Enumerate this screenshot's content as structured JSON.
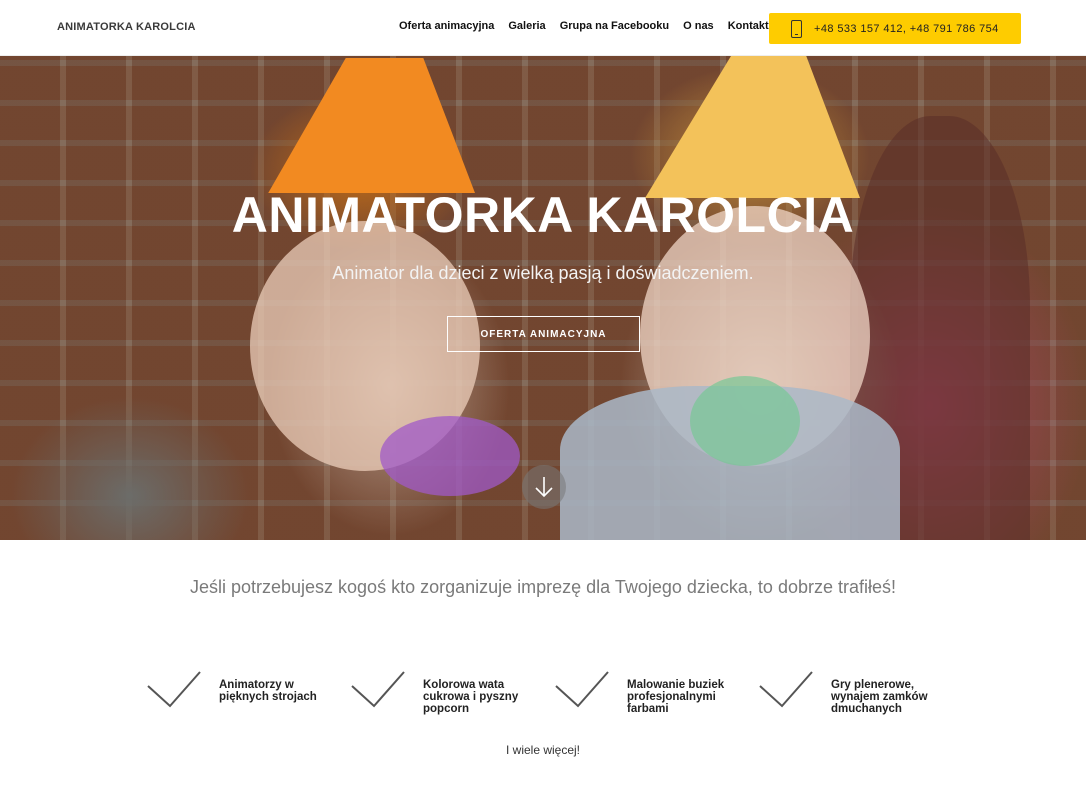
{
  "header": {
    "brand": "ANIMATORKA KAROLCIA",
    "nav": [
      {
        "label": "Oferta animacyjna"
      },
      {
        "label": "Galeria"
      },
      {
        "label": "Grupa na Facebooku"
      },
      {
        "label": "O nas"
      },
      {
        "label": "Kontakt"
      }
    ],
    "phone": {
      "label": "+48 533 157 412, +48 791 786 754",
      "icon": "phone-icon",
      "color": "#fecc00"
    }
  },
  "hero": {
    "title": "ANIMATORKA KAROLCIA",
    "subtitle": "Animator dla dzieci z wielką pasją i doświadczeniem.",
    "cta": "OFERTA ANIMACYJNA",
    "scroll_icon": "arrow-down-icon"
  },
  "intro": {
    "text": "Jeśli potrzebujesz kogoś kto zorganizuje imprezę dla Twojego dziecka, to dobrze trafiłeś!"
  },
  "features": [
    {
      "text": "Animatorzy w pięknych strojach",
      "icon": "check-icon"
    },
    {
      "text": "Kolorowa wata cukrowa i pyszny popcorn",
      "icon": "check-icon"
    },
    {
      "text": "Malowanie buziek profesjonalnymi farbami",
      "icon": "check-icon"
    },
    {
      "text": "Gry plenerowe, wynajem zamków dmuchanych",
      "icon": "check-icon"
    }
  ],
  "more": "I wiele więcej!"
}
